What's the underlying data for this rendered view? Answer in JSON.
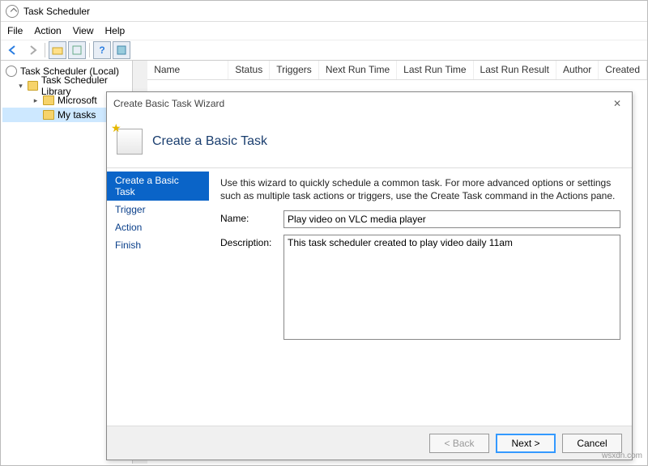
{
  "window": {
    "title": "Task Scheduler"
  },
  "menu": {
    "file": "File",
    "action": "Action",
    "view": "View",
    "help": "Help"
  },
  "tree": {
    "root": "Task Scheduler (Local)",
    "library": "Task Scheduler Library",
    "microsoft": "Microsoft",
    "mytasks": "My tasks"
  },
  "columns": {
    "name": "Name",
    "status": "Status",
    "triggers": "Triggers",
    "nextrun": "Next Run Time",
    "lastrun": "Last Run Time",
    "lastresult": "Last Run Result",
    "author": "Author",
    "created": "Created"
  },
  "wizard": {
    "title": "Create Basic Task Wizard",
    "heading": "Create a Basic Task",
    "steps": {
      "create": "Create a Basic Task",
      "trigger": "Trigger",
      "action": "Action",
      "finish": "Finish"
    },
    "intro": "Use this wizard to quickly schedule a common task.  For more advanced options or settings such as multiple task actions or triggers, use the Create Task command in the Actions pane.",
    "name_label": "Name:",
    "name_value": "Play video on VLC media player",
    "desc_label": "Description:",
    "desc_value": "This task scheduler created to play video daily 11am",
    "buttons": {
      "back": "< Back",
      "next": "Next >",
      "cancel": "Cancel"
    }
  },
  "watermark": "wsxdn.com"
}
